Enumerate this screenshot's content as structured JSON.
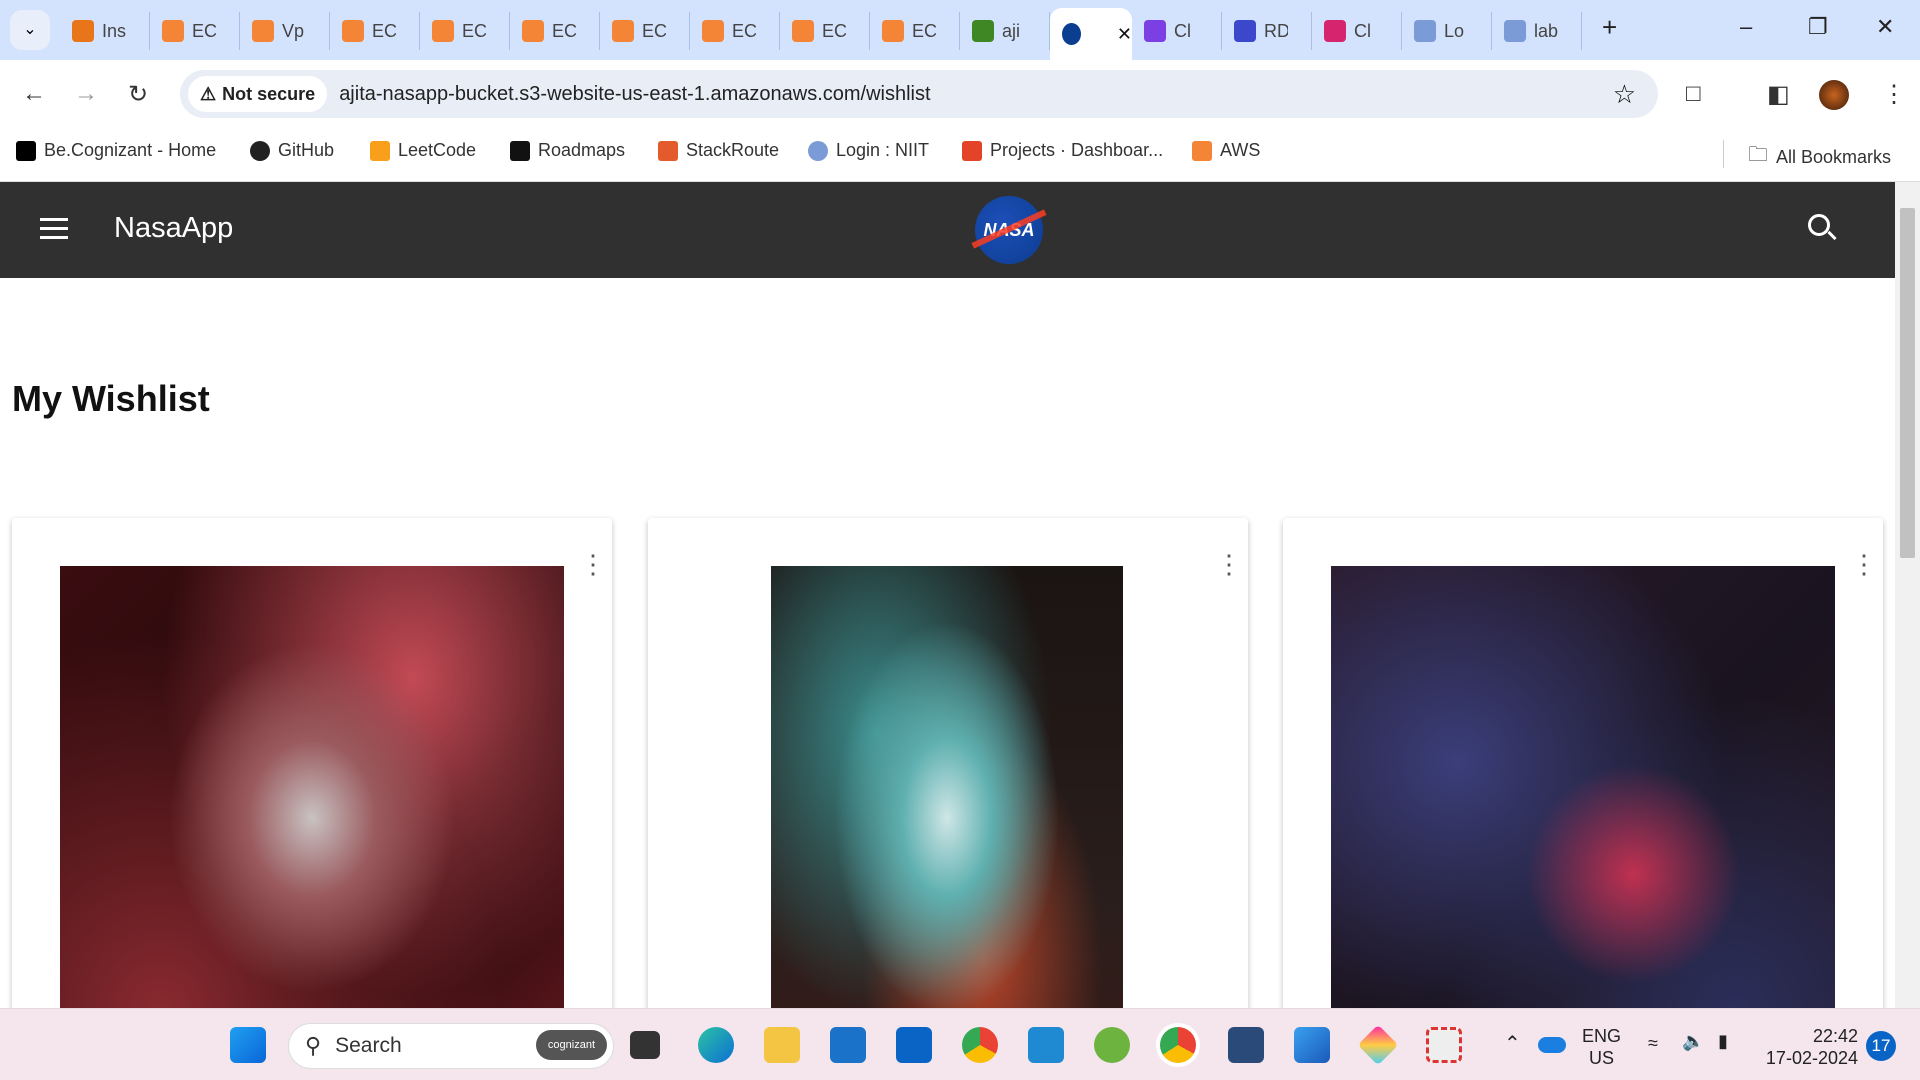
{
  "browser": {
    "tabs": [
      {
        "label": "Ins",
        "color": "#e8751a"
      },
      {
        "label": "EC",
        "color": "#f58536"
      },
      {
        "label": "Vp",
        "color": "#f58536"
      },
      {
        "label": "EC",
        "color": "#f58536"
      },
      {
        "label": "EC",
        "color": "#f58536"
      },
      {
        "label": "EC",
        "color": "#f58536"
      },
      {
        "label": "EC",
        "color": "#f58536"
      },
      {
        "label": "EC",
        "color": "#f58536"
      },
      {
        "label": "EC",
        "color": "#f58536"
      },
      {
        "label": "EC",
        "color": "#f58536"
      },
      {
        "label": "aji",
        "color": "#3f8624"
      },
      {
        "label": "",
        "color": "#0b3d91",
        "active": true
      },
      {
        "label": "Cl",
        "color": "#7b3fe4"
      },
      {
        "label": "RD",
        "color": "#3b48cc"
      },
      {
        "label": "Cl",
        "color": "#d6246e"
      },
      {
        "label": "Lo",
        "color": "#7a9bd6"
      },
      {
        "label": "lab",
        "color": "#7a9bd6"
      }
    ],
    "security_label": "Not secure",
    "url": "ajita-nasapp-bucket.s3-website-us-east-1.amazonaws.com/wishlist",
    "bookmarks": [
      {
        "label": "Be.Cognizant - Home",
        "icon": "be",
        "color": "#000"
      },
      {
        "label": "GitHub",
        "icon": "github",
        "color": "#222"
      },
      {
        "label": "LeetCode",
        "icon": "leetcode",
        "color": "#f89f1b"
      },
      {
        "label": "Roadmaps",
        "icon": "roadmaps",
        "color": "#111"
      },
      {
        "label": "StackRoute",
        "icon": "stackroute",
        "color": "#e35a2d"
      },
      {
        "label": "Login : NIIT",
        "icon": "globe",
        "color": "#7a9bd6"
      },
      {
        "label": "Projects · Dashboar...",
        "icon": "gitlab",
        "color": "#e24329"
      },
      {
        "label": "AWS",
        "icon": "aws",
        "color": "#f58536"
      }
    ],
    "all_bookmarks": "All Bookmarks"
  },
  "app": {
    "title": "NasaApp",
    "logo_text": "NASA",
    "page_title": "My Wishlist",
    "cards": [
      {
        "image": "red-nebula"
      },
      {
        "image": "thors-helmet-nebula"
      },
      {
        "image": "starfield-nebula"
      }
    ]
  },
  "taskbar": {
    "search_placeholder": "Search",
    "search_badge": "cognizant",
    "lang": "ENG",
    "region": "US",
    "time": "22:42",
    "date": "17-02-2024",
    "notifications": "17"
  }
}
